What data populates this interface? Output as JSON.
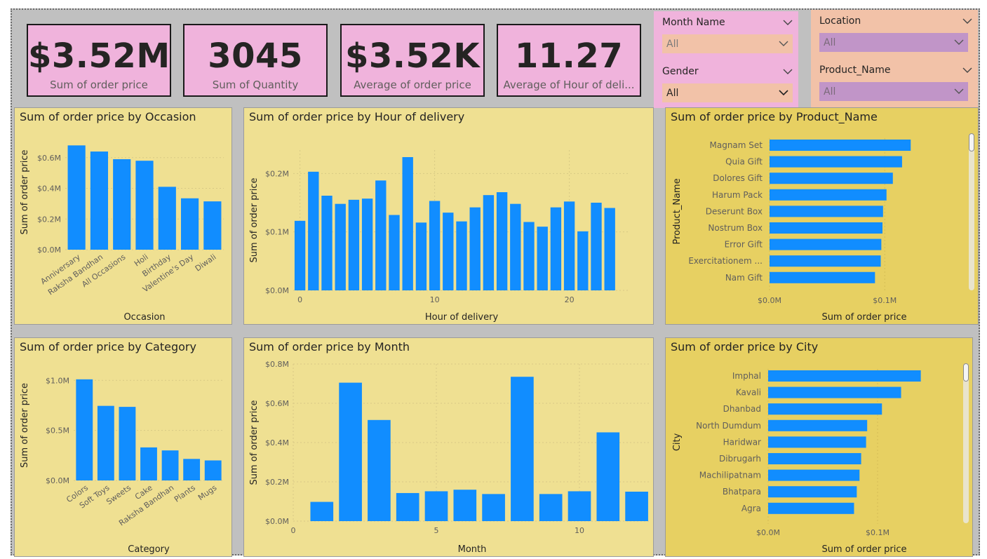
{
  "kpis": [
    {
      "value": "$3.52M",
      "label": "Sum of order price"
    },
    {
      "value": "3045",
      "label": "Sum of Quantity"
    },
    {
      "value": "$3.52K",
      "label": "Average of order price"
    },
    {
      "value": "11.27",
      "label": "Average of Hour of deli..."
    }
  ],
  "slicers": [
    {
      "title": "Month Name",
      "value": "All"
    },
    {
      "title": "Gender",
      "value": "All"
    },
    {
      "title": "Location",
      "value": "All"
    },
    {
      "title": "Product_Name",
      "value": "All"
    }
  ],
  "colors": {
    "bar": "#118dff",
    "panel": "#efe092",
    "panel_alt": "#e7d062",
    "kpi_bg": "#f0b3dc",
    "canvas": "#c0c0c0"
  },
  "chart_data": [
    {
      "id": "occasion",
      "type": "bar",
      "title": "Sum of order price by Occasion",
      "xlabel": "Occasion",
      "ylabel": "Sum of order price",
      "categories": [
        "Anniversary",
        "Raksha Bandhan",
        "All Occasions",
        "Holi",
        "Birthday",
        "Valentine's Day",
        "Diwali"
      ],
      "values": [
        0.68,
        0.64,
        0.59,
        0.58,
        0.41,
        0.335,
        0.315
      ],
      "ylim": [
        0,
        0.75
      ],
      "yticks": [
        "$0.0M",
        "$0.2M",
        "$0.4M",
        "$0.6M"
      ]
    },
    {
      "id": "hour",
      "type": "bar",
      "title": "Sum of order price by Hour of delivery",
      "xlabel": "Hour of delivery",
      "ylabel": "Sum of order price",
      "x": [
        0,
        1,
        2,
        3,
        4,
        5,
        6,
        7,
        8,
        9,
        10,
        11,
        12,
        13,
        14,
        15,
        16,
        17,
        18,
        19,
        20,
        21,
        22,
        23
      ],
      "values": [
        0.119,
        0.203,
        0.162,
        0.148,
        0.155,
        0.157,
        0.188,
        0.129,
        0.228,
        0.116,
        0.153,
        0.133,
        0.118,
        0.142,
        0.163,
        0.168,
        0.148,
        0.117,
        0.109,
        0.142,
        0.152,
        0.101,
        0.15,
        0.141
      ],
      "ylim": [
        0,
        0.24
      ],
      "yticks": [
        "$0.0M",
        "$0.1M",
        "$0.2M"
      ],
      "xticks": [
        "0",
        "10",
        "20"
      ]
    },
    {
      "id": "product",
      "type": "bar",
      "orientation": "horizontal",
      "title": "Sum of order price by Product_Name",
      "xlabel": "Sum of order price",
      "ylabel": "Product_Name",
      "categories": [
        "Magnam Set",
        "Quia Gift",
        "Dolores Gift",
        "Harum Pack",
        "Deserunt Box",
        "Nostrum Box",
        "Error Gift",
        "Exercitationem ...",
        "Nam Gift"
      ],
      "values": [
        0.1225,
        0.115,
        0.107,
        0.1015,
        0.0985,
        0.098,
        0.097,
        0.0965,
        0.0915
      ],
      "xlim": [
        0,
        0.14
      ],
      "xticks": [
        "$0.0M",
        "$0.1M"
      ]
    },
    {
      "id": "category",
      "type": "bar",
      "title": "Sum of order price by Category",
      "xlabel": "Category",
      "ylabel": "Sum of order price",
      "categories": [
        "Colors",
        "Soft Toys",
        "Sweets",
        "Cake",
        "Raksha Bandhan",
        "Plants",
        "Mugs"
      ],
      "values": [
        1.01,
        0.745,
        0.735,
        0.33,
        0.3,
        0.215,
        0.2
      ],
      "ylim": [
        0,
        1.1
      ],
      "yticks": [
        "$0.0M",
        "$0.5M",
        "$1.0M"
      ]
    },
    {
      "id": "month",
      "type": "bar",
      "title": "Sum of order price by Month",
      "xlabel": "Month",
      "ylabel": "Sum of order price",
      "x": [
        1,
        2,
        3,
        4,
        5,
        6,
        7,
        8,
        9,
        10,
        11,
        12
      ],
      "values": [
        0.098,
        0.705,
        0.515,
        0.143,
        0.152,
        0.16,
        0.138,
        0.735,
        0.138,
        0.152,
        0.452,
        0.15
      ],
      "ylim": [
        0,
        0.8
      ],
      "yticks": [
        "$0.0M",
        "$0.2M",
        "$0.4M",
        "$0.6M",
        "$0.8M"
      ],
      "xticks": [
        "0",
        "5",
        "10"
      ]
    },
    {
      "id": "city",
      "type": "bar",
      "orientation": "horizontal",
      "title": "Sum of order price by City",
      "xlabel": "Sum of order price",
      "ylabel": "City",
      "categories": [
        "Imphal",
        "Kavali",
        "Dhanbad",
        "North Dumdum",
        "Haridwar",
        "Dibrugarh",
        "Machilipatnam",
        "Bhatpara",
        "Agra"
      ],
      "values": [
        0.1395,
        0.1215,
        0.104,
        0.0905,
        0.0895,
        0.085,
        0.0835,
        0.081,
        0.0785
      ],
      "xlim": [
        0,
        0.15
      ],
      "xticks": [
        "$0.0M",
        "$0.1M"
      ]
    }
  ]
}
